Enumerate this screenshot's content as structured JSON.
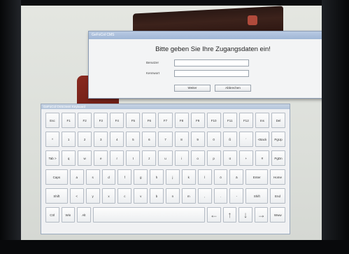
{
  "login": {
    "window_title": "GeFoCol CMS",
    "close_glyph": "x",
    "heading": "Bitte geben Sie Ihre Zugangsdaten ein!",
    "username_label": "Benutzer",
    "password_label": "Kennwort",
    "username_value": "",
    "password_value": "",
    "ok_label": "Weiter",
    "cancel_label": "Abbrechen"
  },
  "keyboard": {
    "title": "GeFoCol OnScreen Keyboard",
    "rows": [
      [
        "Esc",
        "F1",
        "F2",
        "F3",
        "F4",
        "F5",
        "F6",
        "F7",
        "F8",
        "F9",
        "F10",
        "F11",
        "F12",
        "Ins",
        "Del"
      ],
      [
        "^",
        "1",
        "2",
        "3",
        "4",
        "5",
        "6",
        "7",
        "8",
        "9",
        "0",
        "ß",
        "´",
        "<Back",
        "PgUp"
      ],
      [
        "Tab >",
        "q",
        "w",
        "e",
        "r",
        "t",
        "z",
        "u",
        "i",
        "o",
        "p",
        "ü",
        "+",
        "#",
        "PgDn"
      ],
      [
        "Caps",
        "a",
        "s",
        "d",
        "f",
        "g",
        "h",
        "j",
        "k",
        "l",
        "ö",
        "ä",
        "Enter",
        "Home"
      ],
      [
        "Shift",
        "<",
        "y",
        "x",
        "c",
        "v",
        "b",
        "n",
        "m",
        ",",
        ".",
        "-",
        "Shift",
        "End"
      ],
      [
        "Ctrl",
        "Win",
        "Alt",
        "",
        "←",
        "↑",
        "↓",
        "→",
        "Www"
      ]
    ]
  },
  "colors": {
    "dialog_title_bar": "#9fb6d6",
    "close_button": "#c9453a",
    "wallpaper_red": "#8a2a20"
  }
}
